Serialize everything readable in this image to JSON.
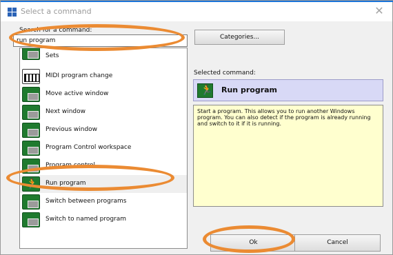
{
  "window": {
    "title": "Select a command",
    "close_glyph": "✕",
    "accent": "#1b74d9"
  },
  "search": {
    "prompt": "Search for a command:",
    "value": "run program"
  },
  "categories_button": "Categories...",
  "commands": [
    {
      "label": "Sets",
      "icon": "window-icon",
      "partial": true
    },
    {
      "label": "MIDI program change",
      "icon": "midi-keyboard-icon"
    },
    {
      "label": "Move active window",
      "icon": "window-icon"
    },
    {
      "label": "Next window",
      "icon": "window-icon"
    },
    {
      "label": "Previous window",
      "icon": "window-icon"
    },
    {
      "label": "Program Control workspace",
      "icon": "window-icon"
    },
    {
      "label": "Program control...",
      "icon": "window-icon"
    },
    {
      "label": "Run program",
      "icon": "run-icon",
      "selected": true
    },
    {
      "label": "Switch between programs",
      "icon": "window-icon"
    },
    {
      "label": "Switch to named program",
      "icon": "window-icon"
    }
  ],
  "selected": {
    "caption": "Selected command:",
    "name": "Run program",
    "description": "Start a program. This allows you to run another Windows program. You can also detect if the program is already running and switch to it if it is running."
  },
  "buttons": {
    "ok": "Ok",
    "cancel": "Cancel"
  },
  "highlight_color": "#eb8b33"
}
